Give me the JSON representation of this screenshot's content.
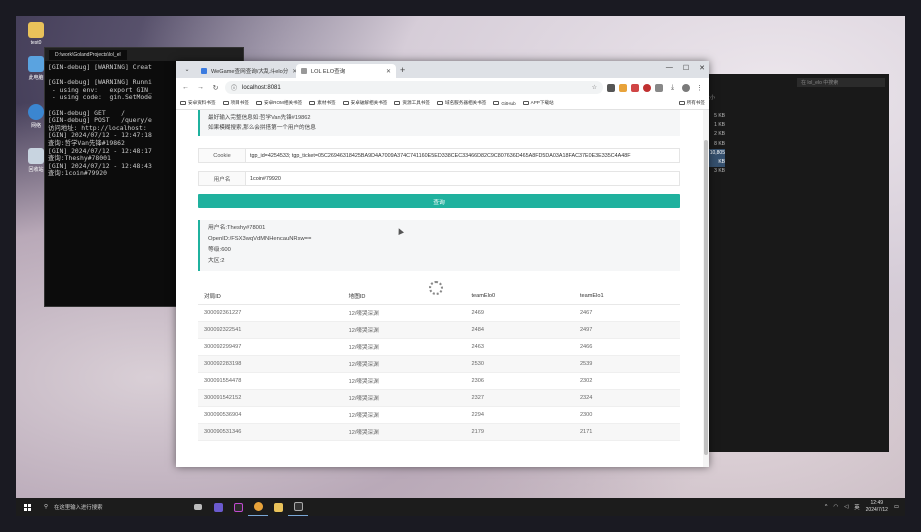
{
  "desktop": {
    "icons": [
      {
        "label": "test0"
      },
      {
        "label": "此电脑"
      },
      {
        "label": "网络"
      },
      {
        "label": "回收站"
      }
    ]
  },
  "terminal": {
    "tab_title": "D:\\work\\GolandProjects\\lol_el",
    "lines": [
      "[GIN-debug] [WARNING] Creat",
      "",
      "[GIN-debug] [WARNING] Runni",
      " - using env:   export GIN_",
      " - using code:  gin.SetMode",
      "",
      "[GIN-debug] GET    /",
      "[GIN-debug] POST   /query/e",
      "访问地址: http://localhost:",
      "[GIN] 2024/07/12 - 12:47:18",
      "查询:哲学Van先锋#19862",
      "[GIN] 2024/07/12 - 12:48:17",
      "查询:Theshy#78001",
      "[GIN] 2024/07/12 - 12:48:43",
      "查询:1coin#79920"
    ]
  },
  "explorer": {
    "search_placeholder": "在 lol_elo 中搜索",
    "column_label": "大小",
    "sizes": [
      "5 KB",
      "1 KB",
      "2 KB",
      "8 KB",
      "10,805 KB",
      "3 KB"
    ]
  },
  "browser": {
    "tabs": [
      {
        "title": "WeGame查网查询/大乱斗elo分",
        "active": false
      },
      {
        "title": "LOL ELO查询",
        "active": true
      }
    ],
    "url": "localhost:8081",
    "bookmarks": [
      "安卓资料书签",
      "项目书签",
      "安卓ROM相关书签",
      "素材书签",
      "安卓破解相关书签",
      "资源工具书签",
      "域名服务器相关书签",
      "GitHub",
      "APP下载站"
    ],
    "bookmarks_all": "所有书签"
  },
  "page": {
    "tips": [
      "最好输入完整信息如:哲学Van先锋#19862",
      "如果模糊搜索,那么会拼搭第一个用户的信息"
    ],
    "cookie_label": "Cookie",
    "cookie_value": "tgp_id=4254533; tgp_ticket=05C26946318425BA9D4A7009A374C741160E5ED338CEC33466D82C9C807636D465A8FD5DA03A18FAC37E0E3E335C4A48F",
    "username_label": "用户名",
    "username_value": "1coin#79920",
    "query_button": "查询",
    "result": {
      "name": "用户名:Theshy#78001",
      "openid": "OpenID:/FSX3wqVdMNHencauNRsw==",
      "level": "等级:600",
      "region": "大区:2"
    },
    "table": {
      "headers": [
        "对局ID",
        "地图ID",
        "teamElo0",
        "teamElo1"
      ],
      "rows": [
        [
          "300092361227",
          "12/嚎哭深渊",
          "2469",
          "2467"
        ],
        [
          "300092322541",
          "12/嚎哭深渊",
          "2484",
          "2497"
        ],
        [
          "300092299497",
          "12/嚎哭深渊",
          "2463",
          "2466"
        ],
        [
          "300092283198",
          "12/嚎哭深渊",
          "2530",
          "2539"
        ],
        [
          "300091554478",
          "12/嚎哭深渊",
          "2306",
          "2302"
        ],
        [
          "300091542152",
          "12/嚎哭深渊",
          "2327",
          "2324"
        ],
        [
          "300090536904",
          "12/嚎哭深渊",
          "2294",
          "2300"
        ],
        [
          "300090531346",
          "12/嚎哭深渊",
          "2179",
          "2171"
        ]
      ]
    }
  },
  "taskbar": {
    "search_placeholder": "在这里输入进行搜索",
    "lang": "英",
    "time": "12:49",
    "date": "2024/7/12"
  },
  "colors": {
    "accent": "#1fb19e"
  }
}
